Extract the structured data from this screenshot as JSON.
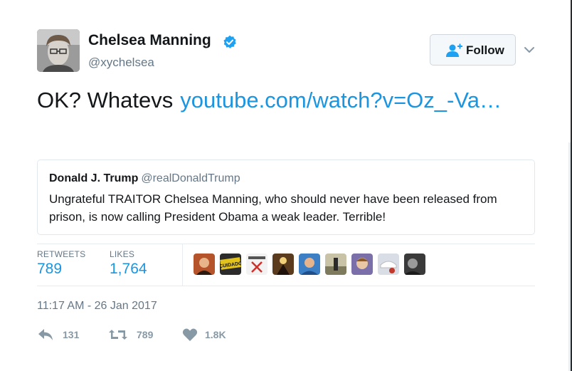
{
  "author": {
    "name": "Chelsea Manning",
    "handle": "@xychelsea",
    "verified": true,
    "avatar_icon": "profile-photo"
  },
  "follow_button": {
    "label": "Follow",
    "icon": "add-user-icon"
  },
  "tweet": {
    "text": "OK? Whatevs",
    "link_text": "youtube.com/watch?v=Oz_-Va…"
  },
  "quoted_tweet": {
    "name": "Donald J. Trump",
    "handle": "@realDonaldTrump",
    "text": "Ungrateful TRAITOR Chelsea Manning, who should never have been released from prison, is now calling President Obama a weak leader. Terrible!"
  },
  "stats": {
    "retweets_label": "RETWEETS",
    "retweets_value": "789",
    "likes_label": "LIKES",
    "likes_value": "1,764"
  },
  "likers": [
    {
      "icon": "liker-avatar-1",
      "color": "#b5532a"
    },
    {
      "icon": "liker-avatar-cuidado",
      "color": "#e2c21c",
      "label": "CUIDADO"
    },
    {
      "icon": "liker-avatar-3",
      "color": "#e8e8e8"
    },
    {
      "icon": "liker-avatar-4",
      "color": "#5a3b1e"
    },
    {
      "icon": "liker-avatar-5",
      "color": "#3d7fc4"
    },
    {
      "icon": "liker-avatar-6",
      "color": "#9e9a7a"
    },
    {
      "icon": "liker-avatar-7",
      "color": "#7a6fa8"
    },
    {
      "icon": "liker-avatar-8",
      "color": "#d8dde6"
    },
    {
      "icon": "liker-avatar-9",
      "color": "#3a3a3a"
    }
  ],
  "timestamp": "11:17 AM - 26 Jan 2017",
  "actions": {
    "reply_count": "131",
    "retweet_count": "789",
    "like_count": "1.8K"
  },
  "colors": {
    "link": "#1b95e0",
    "muted": "#657786",
    "action": "#8899a6",
    "verified": "#1da1f2"
  }
}
